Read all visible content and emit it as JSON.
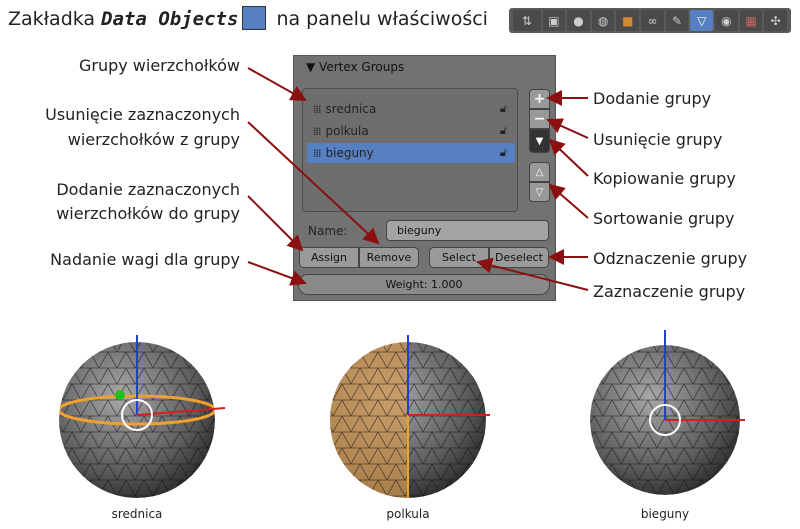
{
  "title": {
    "prefix": "Zakładka ",
    "emph": "Data Objects",
    "suffix": " na panelu właściwości"
  },
  "toolbar": {
    "icons": [
      "display-toggle",
      "render",
      "scene",
      "world",
      "object",
      "constraints",
      "modifiers",
      "data",
      "material",
      "texture",
      "particles"
    ],
    "selected": "data"
  },
  "panel": {
    "header": "▼ Vertex Groups",
    "groups": [
      {
        "name": "srednica",
        "selected": false
      },
      {
        "name": "polkula",
        "selected": false
      },
      {
        "name": "bieguny",
        "selected": true
      }
    ],
    "name_label": "Name:",
    "name_value": "bieguny",
    "assign": "Assign",
    "remove": "Remove",
    "select": "Select",
    "deselect": "Deselect",
    "weight": "Weight: 1.000",
    "selection_color": "#5680c2"
  },
  "left_labels": {
    "groups": "Grupy wierzchołków",
    "remove1": "Usunięcie zaznaczonych",
    "remove2": "wierzchołków z grupy",
    "assign1": "Dodanie zaznaczonych",
    "assign2": "wierzchołków do grupy",
    "weight": "Nadanie wagi dla grupy"
  },
  "right_labels": {
    "add": "Dodanie grupy",
    "del": "Usunięcie grupy",
    "copy": "Kopiowanie grupy",
    "sort": "Sortowanie grupy",
    "deselect": "Odznaczenie grupy",
    "select": "Zaznaczenie grupy"
  },
  "captions": [
    "srednica",
    "polkula",
    "bieguny"
  ],
  "colors": {
    "arrow": "#8b1010",
    "highlight": "#f0a030"
  }
}
